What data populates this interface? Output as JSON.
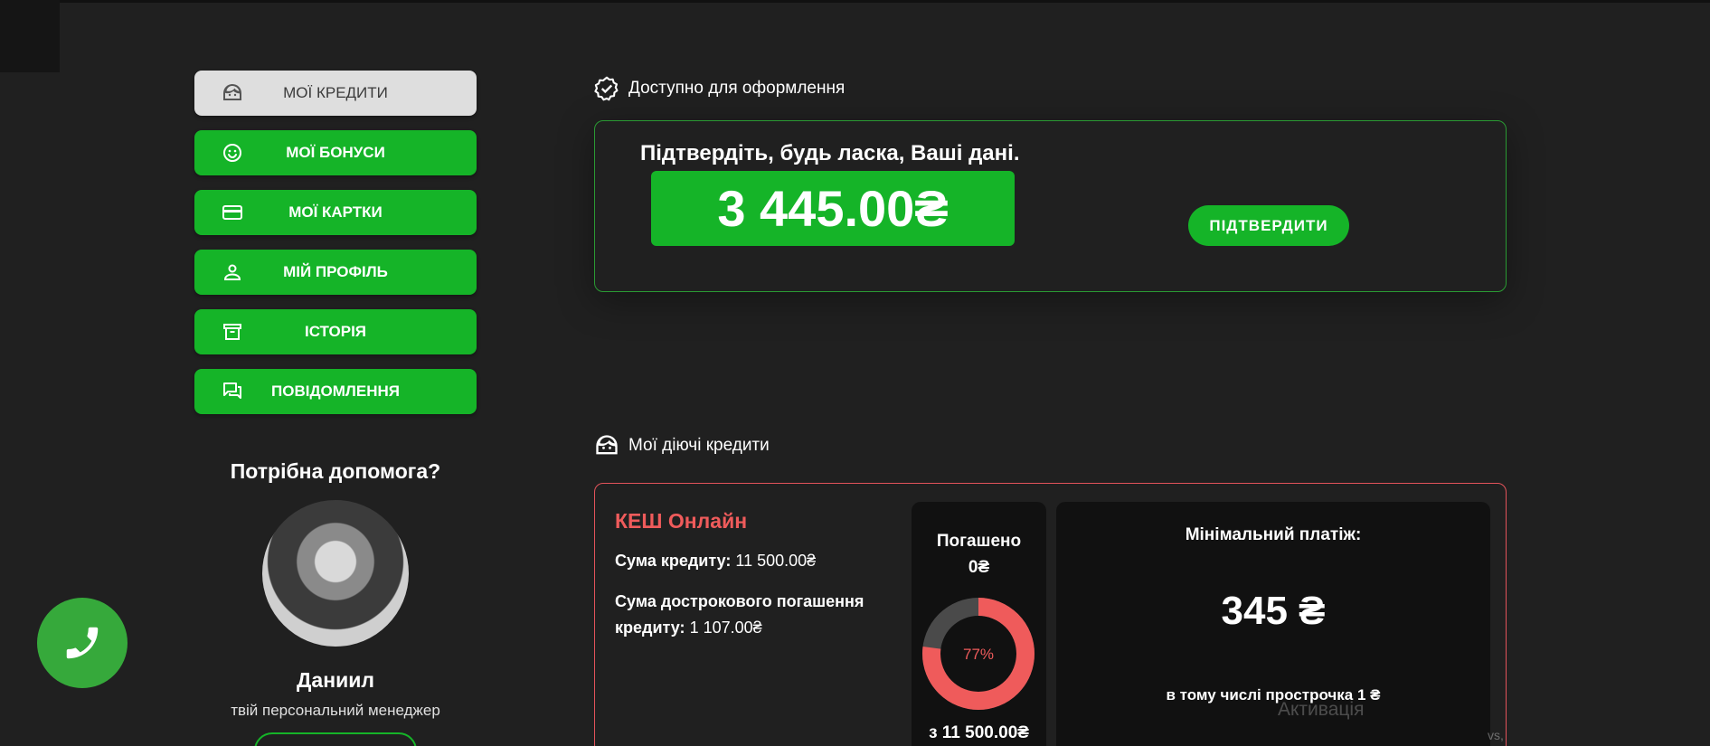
{
  "sidebar": {
    "items": [
      {
        "label": "МОЇ КРЕДИТИ",
        "icon": "face-icon",
        "active": true
      },
      {
        "label": "МОЇ БОНУСИ",
        "icon": "smile-icon",
        "active": false
      },
      {
        "label": "МОЇ КАРТКИ",
        "icon": "credit-card-icon",
        "active": false
      },
      {
        "label": "МІЙ ПРОФІЛЬ",
        "icon": "person-icon",
        "active": false
      },
      {
        "label": "ІСТОРІЯ",
        "icon": "archive-icon",
        "active": false
      },
      {
        "label": "ПОВІДОМЛЕННЯ",
        "icon": "chat-icon",
        "active": false
      }
    ]
  },
  "help": {
    "title": "Потрібна допомога?",
    "manager_name": "Даниил",
    "manager_role": "твій персональний менеджер"
  },
  "available": {
    "heading": "Доступно для оформлення",
    "confirm_title": "Підтвердіть, будь ласка, Ваші дані.",
    "amount": "3 445.00₴",
    "confirm_button": "ПІДТВЕРДИТИ"
  },
  "active_credits": {
    "heading": "Мої діючі кредити",
    "credit": {
      "name": "КЕШ Онлайн",
      "sum_label": "Сума кредиту:",
      "sum_value": "11 500.00₴",
      "early_label": "Сума дострокового погашення кредиту:",
      "early_value": "1 107.00₴",
      "paid_title": "Погашено",
      "paid_value": "0₴",
      "paid_percent": "77%",
      "paid_fraction": 0.77,
      "paid_total": "з 11 500.00₴",
      "min_payment_title": "Мінімальний платіж:",
      "min_payment_amount": "345 ₴",
      "overdue": "в тому числі прострочка 1 ₴"
    }
  },
  "colors": {
    "green": "#15b428",
    "red": "#ef5b5b",
    "background": "#202020"
  },
  "watermark": "Активація",
  "watermark_small": "vs,"
}
